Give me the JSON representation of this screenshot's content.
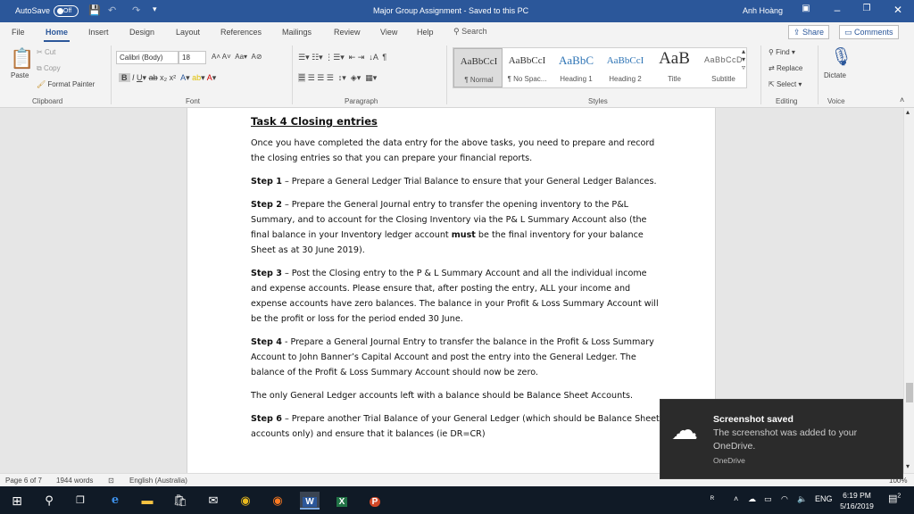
{
  "titlebar": {
    "autosave_label": "AutoSave",
    "autosave_state": "Off",
    "doc_title": "Major Group Assignment  -  Saved to this PC",
    "user_name": "Anh Hoàng"
  },
  "menu": {
    "tabs": [
      "File",
      "Home",
      "Insert",
      "Design",
      "Layout",
      "References",
      "Mailings",
      "Review",
      "View",
      "Help"
    ],
    "active_tab": "Home",
    "search_label": "Search",
    "share_label": "Share",
    "comments_label": "Comments"
  },
  "ribbon": {
    "clipboard": {
      "paste": "Paste",
      "cut": "Cut",
      "copy": "Copy",
      "format_painter": "Format Painter",
      "group": "Clipboard"
    },
    "font": {
      "name": "Calibri (Body)",
      "size": "18",
      "group": "Font"
    },
    "paragraph": {
      "group": "Paragraph"
    },
    "styles": {
      "group": "Styles",
      "items": [
        {
          "preview": "AaBbCcI",
          "name": "¶ Normal"
        },
        {
          "preview": "AaBbCcI",
          "name": "¶ No Spac..."
        },
        {
          "preview": "AaBbC",
          "name": "Heading 1"
        },
        {
          "preview": "AaBbCcI",
          "name": "Heading 2"
        },
        {
          "preview": "AaB",
          "name": "Title"
        },
        {
          "preview": "AaBbCcD",
          "name": "Subtitle"
        }
      ]
    },
    "editing": {
      "find": "Find",
      "replace": "Replace",
      "select": "Select",
      "group": "Editing"
    },
    "voice": {
      "dictate": "Dictate",
      "group": "Voice"
    }
  },
  "document": {
    "heading": "Task 4 Closing entries",
    "intro": "Once you have completed the data entry for the above tasks, you need to prepare and record the closing entries so that you can prepare your financial reports.",
    "step1_label": "Step 1",
    "step1_text": " – Prepare a General Ledger Trial Balance to ensure that your General Ledger Balances.",
    "step2_label": "Step 2",
    "step2_text_a": " – Prepare the General Journal entry to transfer the opening inventory to the P&L Summary, and to account for the Closing Inventory via the P& L Summary Account also (the final balance in your Inventory ledger account ",
    "step2_must": "must",
    "step2_text_b": " be the final inventory for your balance Sheet as at 30 June 2019).",
    "step3_label": "Step 3",
    "step3_text": " – Post the Closing entry to the P & L Summary Account and all the individual income and expense accounts. Please ensure that, after posting the entry, ALL your income and expense accounts have zero balances. The balance in your Profit & Loss Summary Account will be the profit or loss for the period ended 30 June.",
    "step4_label": "Step 4",
    "step4_text": " - Prepare a General Journal Entry to transfer the balance in the Profit & Loss Summary Account to John Banner’s Capital Account and post the entry into the General Ledger. The balance of the Profit & Loss Summary Account should now be zero.",
    "note": "The only General Ledger accounts left with a balance should be Balance Sheet Accounts.",
    "step6_label": "Step 6",
    "step6_text": " – Prepare another Trial Balance of your General Ledger (which should be Balance Sheet accounts only) and ensure that it balances (ie DR=CR)"
  },
  "status": {
    "page": "Page 6 of 7",
    "words": "1944 words",
    "language": "English (Australia)",
    "zoom": "100%"
  },
  "toast": {
    "title": "Screenshot saved",
    "body": "The screenshot was added to your OneDrive.",
    "source": "OneDrive"
  },
  "taskbar": {
    "time": "6:19 PM",
    "date": "5/16/2019",
    "lang": "ENG",
    "notifications": "2"
  }
}
